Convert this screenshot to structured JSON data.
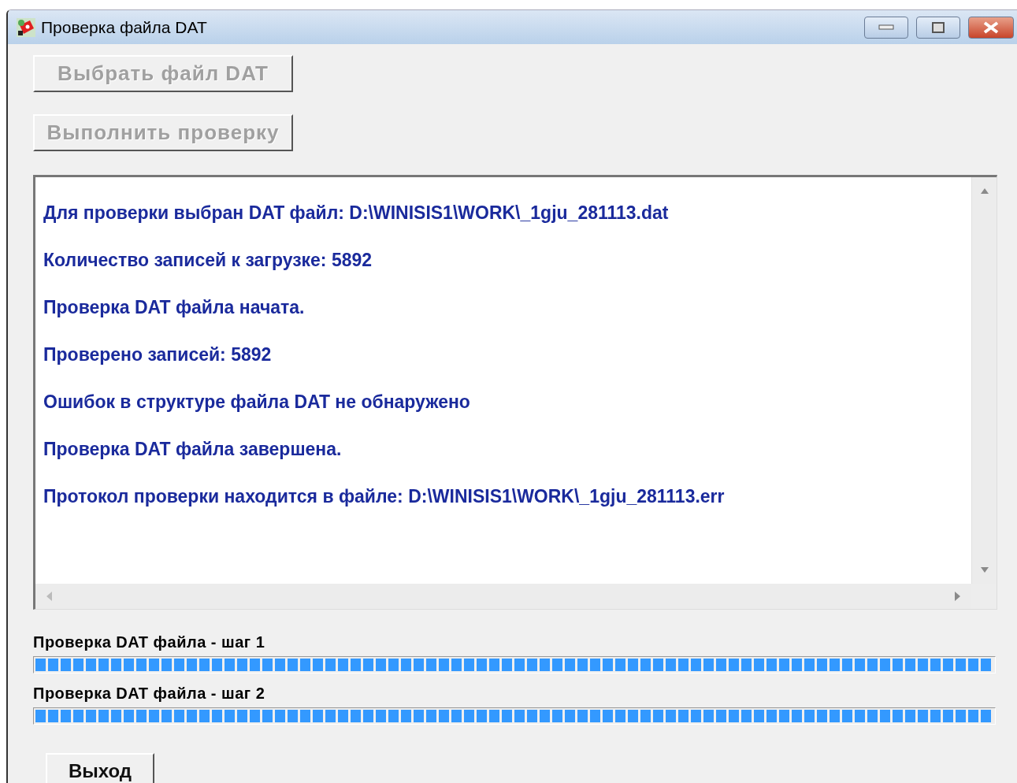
{
  "window": {
    "title": "Проверка файла DAT"
  },
  "actions": [
    {
      "label": "Выбрать файл DAT",
      "disabled": true
    },
    {
      "label": "Выполнить проверку",
      "disabled": true
    }
  ],
  "log": [
    "Для проверки выбран DAT файл: D:\\WINISIS1\\WORK\\_1gju_281113.dat",
    "Количество записей к загрузке: 5892",
    "Проверка DAT файла начата.",
    "Проверено записей: 5892",
    "Ошибок в структуре файла DAT не обнаружено",
    "Проверка DAT файла завершена.",
    "Протокол проверки находится в файле: D:\\WINISIS1\\WORK\\_1gju_281113.err"
  ],
  "progress": [
    {
      "label": "Проверка DAT файла - шаг 1",
      "level": 1
    },
    {
      "label": "Проверка DAT файла - шаг 2",
      "level": 1
    }
  ],
  "exit_button": {
    "label": "Выход",
    "disabled": false
  }
}
